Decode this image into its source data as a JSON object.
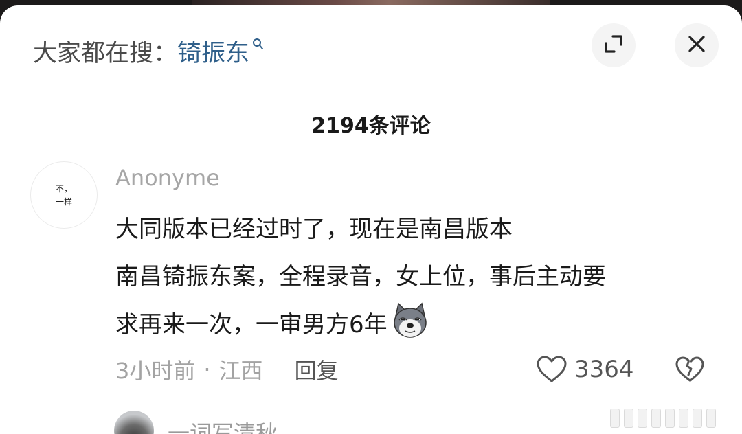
{
  "search": {
    "prefix": "大家都在搜：",
    "term": "锜振东"
  },
  "header": {
    "comment_count": "2194条评论"
  },
  "comment": {
    "avatar_text_1": "不，",
    "avatar_text_2": "一样",
    "username": "Anonyme",
    "lines": [
      "大同版本已经过时了，现在是南昌版本",
      "南昌锜振东案，全程录音，女上位，事后主动要",
      "求再来一次，一审男方6年"
    ],
    "emoji": "dog-face-emoji",
    "time": "3小时前",
    "separator": "·",
    "location": "江西",
    "reply_label": "回复",
    "like_count": "3364"
  },
  "next_comment": {
    "username": "一词写清秋"
  },
  "icons": {
    "search": "search-icon",
    "expand": "expand-icon",
    "close": "close-icon",
    "like": "heart-icon",
    "dislike": "broken-heart-icon"
  },
  "colors": {
    "search_term": "#2f5f8a",
    "muted_text": "#a6a6a6",
    "button_bg": "#f4f4f4"
  }
}
